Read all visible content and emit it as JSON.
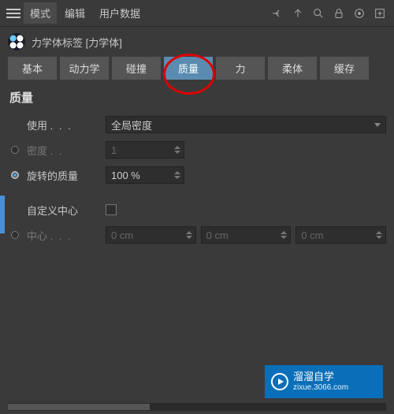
{
  "topbar": {
    "menu": {
      "mode": "模式",
      "edit": "编辑",
      "userdata": "用户数据"
    }
  },
  "tag": {
    "title": "力学体标签 [力学体]"
  },
  "tabs": {
    "basic": "基本",
    "dynamics": "动力学",
    "collision": "碰撞",
    "mass": "质量",
    "force": "力",
    "softbody": "柔体",
    "cache": "缓存"
  },
  "section": {
    "title": "质量"
  },
  "fields": {
    "use": {
      "label": "使用",
      "dots": ". . .",
      "value": "全局密度"
    },
    "density": {
      "label": "密度",
      "dots": ". .",
      "value": "1"
    },
    "rotmass": {
      "label": "旋转的质量",
      "value": "100 %"
    },
    "customcenter": {
      "label": "自定义中心"
    },
    "center": {
      "label": "中心",
      "dots": ". . .",
      "x": "0 cm",
      "y": "0 cm",
      "z": "0 cm"
    }
  },
  "watermark": {
    "brand": "溜溜自学",
    "url": "zixue.3066.com"
  }
}
